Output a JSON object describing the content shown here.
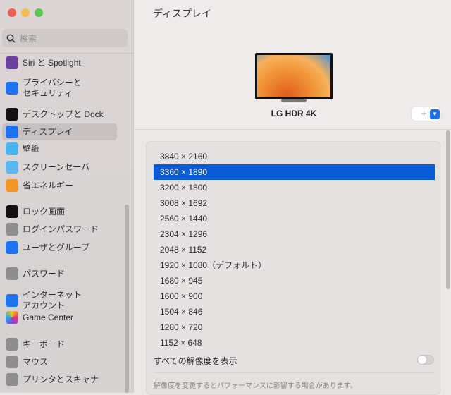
{
  "window": {
    "title": "ディスプレイ"
  },
  "sidebar": {
    "search_placeholder": "検索",
    "items": [
      {
        "label": "Siri と Spotlight",
        "icon": "siri-icon",
        "color": "#6a3fa0"
      },
      {
        "label": "プライバシーと\nセキュリティ",
        "icon": "hand-icon",
        "color": "#1e74f0"
      },
      {
        "label": "デスクトップと Dock",
        "icon": "dock-icon",
        "color": "#111111"
      },
      {
        "label": "ディスプレイ",
        "icon": "display-brightness-icon",
        "color": "#1e74f0"
      },
      {
        "label": "壁紙",
        "icon": "wallpaper-flower-icon",
        "color": "#49b4f0"
      },
      {
        "label": "スクリーンセーバ",
        "icon": "screensaver-icon",
        "color": "#5ab6ee"
      },
      {
        "label": "省エネルギー",
        "icon": "lightbulb-icon",
        "color": "#f5962a"
      },
      {
        "label": "ロック画面",
        "icon": "lock-screen-icon",
        "color": "#111111"
      },
      {
        "label": "ログインパスワード",
        "icon": "lock-icon",
        "color": "#8e8e8e"
      },
      {
        "label": "ユーザとグループ",
        "icon": "users-icon",
        "color": "#1e74f0"
      },
      {
        "label": "パスワード",
        "icon": "key-icon",
        "color": "#8e8e8e"
      },
      {
        "label": "インターネット\nアカウント",
        "icon": "at-icon",
        "color": "#1e74f0"
      },
      {
        "label": "Game Center",
        "icon": "game-center-icon",
        "color": "#ffffff"
      },
      {
        "label": "キーボード",
        "icon": "keyboard-icon",
        "color": "#8e8e8e"
      },
      {
        "label": "マウス",
        "icon": "mouse-icon",
        "color": "#8e8e8e"
      },
      {
        "label": "プリンタとスキャナ",
        "icon": "printer-icon",
        "color": "#8e8e8e"
      }
    ],
    "selected_index": 3
  },
  "display": {
    "name": "LG HDR 4K",
    "add_symbol": "+"
  },
  "resolutions": {
    "options": [
      "3840 × 2160",
      "3360 × 1890",
      "3200 × 1800",
      "3008 × 1692",
      "2560 × 1440",
      "2304 × 1296",
      "2048 × 1152",
      "1920 × 1080（デフォルト）",
      "1680 × 945",
      "1600 × 900",
      "1504 × 846",
      "1280 × 720",
      "1152 × 648"
    ],
    "selected_index": 1,
    "show_all_label": "すべての解像度を表示",
    "show_all_enabled": false,
    "note": "解像度を変更するとパフォーマンスに影響する場合があります。"
  },
  "colors": {
    "accent": "#0a5bd6"
  }
}
